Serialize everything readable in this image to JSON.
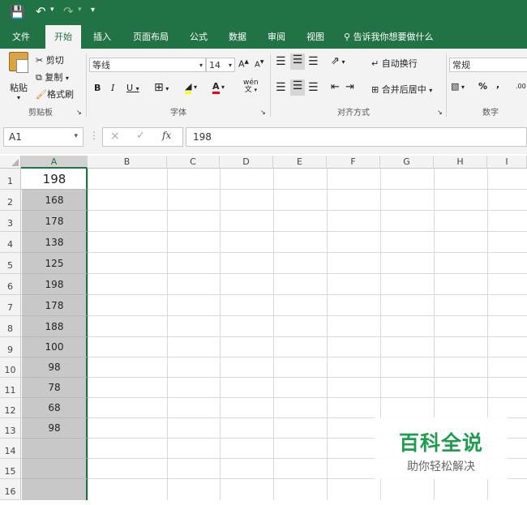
{
  "quick_access": {
    "save_icon": "save-icon",
    "undo_icon": "undo-icon",
    "redo_icon": "redo-icon",
    "customize_icon": "customize-qat-icon"
  },
  "tabs": [
    {
      "label": "文件"
    },
    {
      "label": "开始"
    },
    {
      "label": "插入"
    },
    {
      "label": "页面布局"
    },
    {
      "label": "公式"
    },
    {
      "label": "数据"
    },
    {
      "label": "审阅"
    },
    {
      "label": "视图"
    }
  ],
  "tell_me": "告诉我你想要做什么",
  "clipboard": {
    "paste": "粘贴",
    "cut": "剪切",
    "copy": "复制",
    "format_painter": "格式刷",
    "group": "剪贴板"
  },
  "font": {
    "name": "等线",
    "size": "14",
    "group": "字体",
    "bold": "B",
    "italic": "I",
    "underline": "U",
    "grow": "A",
    "shrink": "A",
    "pinyin": "wén",
    "fill_color": "#ffff00",
    "font_color": "#ff0000"
  },
  "alignment": {
    "wrap": "自动换行",
    "merge": "合并后居中",
    "group": "对齐方式"
  },
  "number": {
    "format": "常规",
    "percent": "%",
    "comma": ",",
    "group": "数字",
    "decimals": ".00"
  },
  "formula_bar": {
    "name_box": "A1",
    "cancel": "×",
    "enter": "✓",
    "fx": "fx",
    "value": "198"
  },
  "columns": [
    "A",
    "B",
    "C",
    "D",
    "E",
    "F",
    "G",
    "H",
    "I"
  ],
  "rows": [
    "1",
    "2",
    "3",
    "4",
    "5",
    "6",
    "7",
    "8",
    "9",
    "10",
    "11",
    "12",
    "13",
    "14",
    "15",
    "16"
  ],
  "column_a_values": [
    "198",
    "168",
    "178",
    "138",
    "125",
    "198",
    "178",
    "188",
    "100",
    "98",
    "78",
    "68",
    "98"
  ],
  "watermark": {
    "title": "百科全说",
    "subtitle": "助你轻松解决"
  },
  "colors": {
    "excel_green": "#217346",
    "selection_fill": "#c8c8c8",
    "selection_border": "#217346"
  }
}
